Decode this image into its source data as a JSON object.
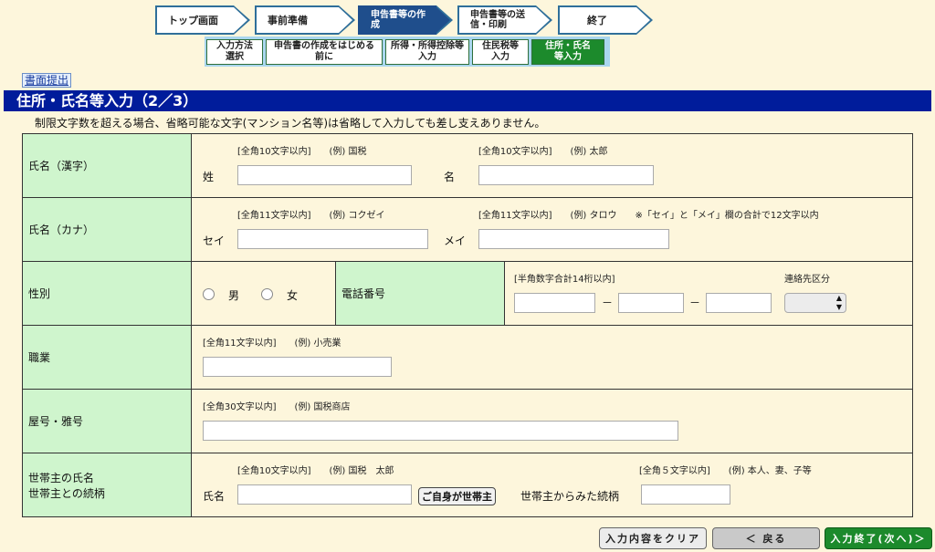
{
  "steps": [
    "トップ画面",
    "事前準備",
    "申告書等の作成",
    "申告書等の送信・印刷",
    "終了"
  ],
  "substeps": [
    "入力方法選択",
    "申告書の作成をはじめる前に",
    "所得・所得控除等入力",
    "住民税等入力",
    "住所・氏名等入力"
  ],
  "submit_paper": "書面提出",
  "title": "住所・氏名等入力（2／3）",
  "note": "制限文字数を超える場合、省略可能な文字(マンション名等)は省略して入力しても差し支えありません。",
  "rows": {
    "kanji": {
      "label": "氏名（漢字）",
      "hint1": "[全角10文字以内]　　(例) 国税",
      "hint2": "[全角10文字以内]　　(例) 太郎",
      "sei": "姓",
      "mei": "名"
    },
    "kana": {
      "label": "氏名（カナ）",
      "hint1": "[全角11文字以内]　　(例) コクゼイ",
      "hint2": "[全角11文字以内]　　(例) タロウ　　※「セイ」と「メイ」欄の合計で12文字以内",
      "sei": "セイ",
      "mei": "メイ"
    },
    "gender": {
      "label": "性別",
      "male": "男",
      "female": "女",
      "phone_label": "電話番号",
      "phone_hint": "[半角数字合計14桁以内]",
      "contact_label": "連絡先区分",
      "dash": "－"
    },
    "job": {
      "label": "職業",
      "hint": "[全角11文字以内]　　(例) 小売業"
    },
    "yago": {
      "label": "屋号・雅号",
      "hint": "[全角30文字以内]　　(例) 国税商店"
    },
    "householder": {
      "label1": "世帯主の氏名",
      "label2": "世帯主との続柄",
      "hint1": "[全角10文字以内]　　(例) 国税　太郎",
      "hint2": "[全角５文字以内]　　(例) 本人、妻、子等",
      "name": "氏名",
      "self_btn": "ご自身が世帯主",
      "relation": "世帯主からみた続柄"
    }
  },
  "buttons": {
    "clear": "入力内容をクリア",
    "back": "＜ 戻る",
    "next": "入力終了(次へ)＞"
  },
  "colors": {
    "title_bg": "#001c9b",
    "label_bg": "#cff5cd",
    "current_substep": "#1c8a2c"
  }
}
